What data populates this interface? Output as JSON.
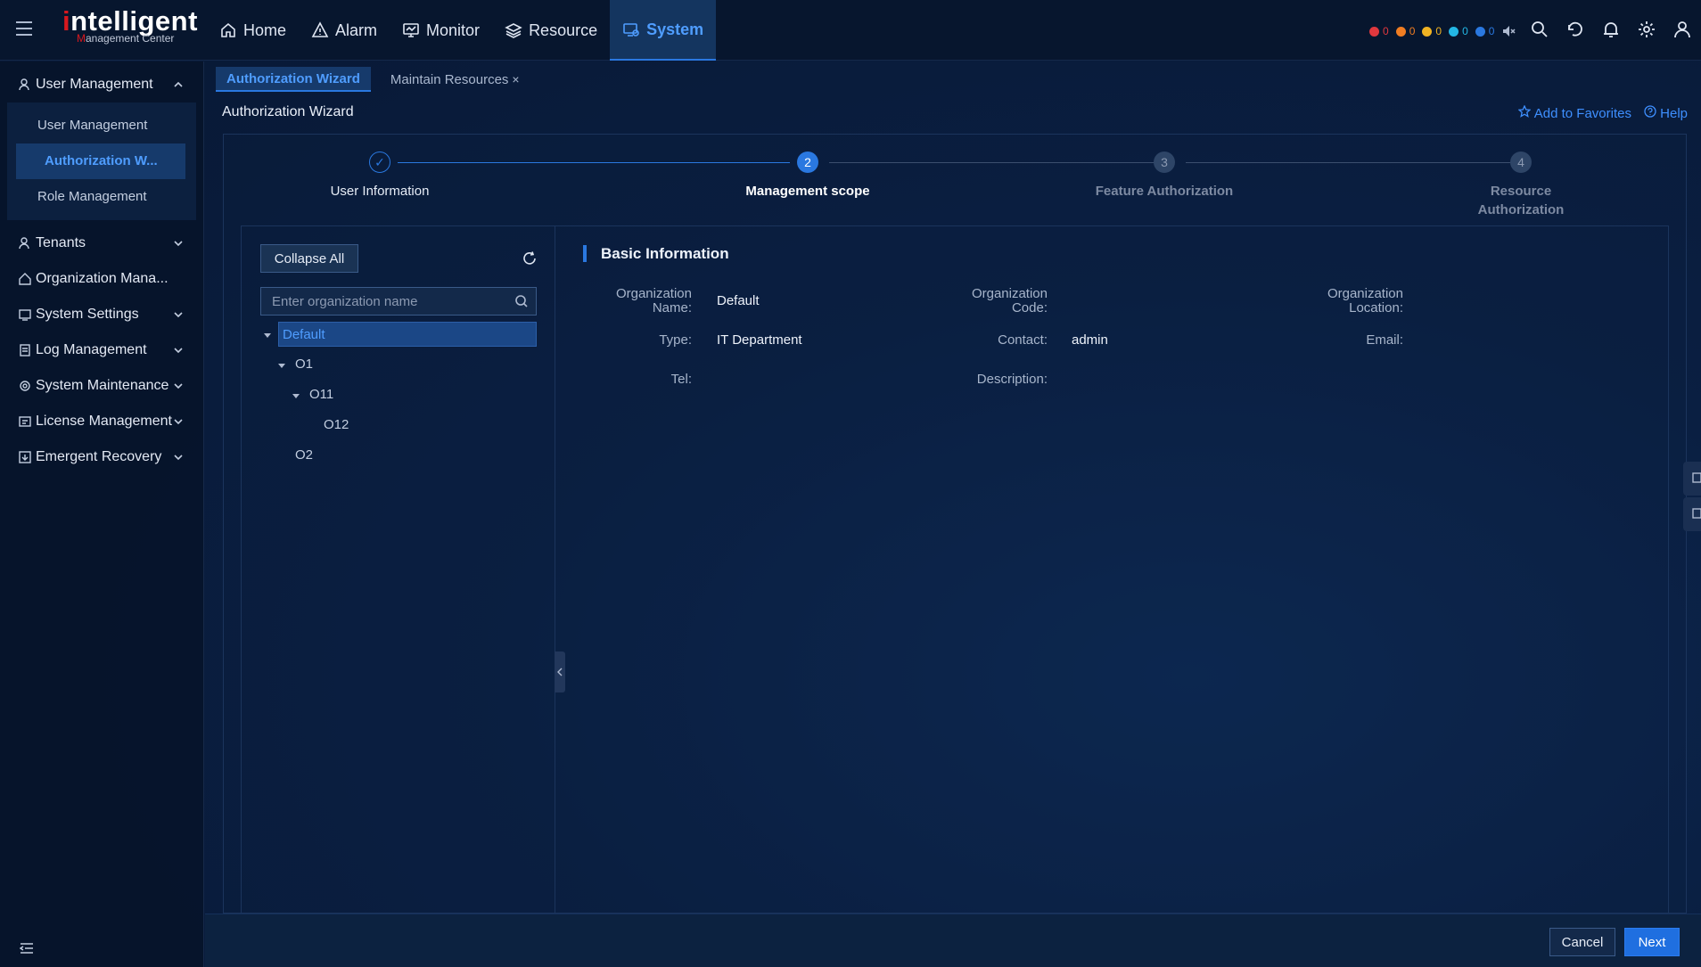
{
  "logo": {
    "initial": "i",
    "main": "ntelligent",
    "sub_initial": "M",
    "sub_rest": "anagement Center"
  },
  "nav": [
    {
      "label": "Home",
      "icon": "home-icon"
    },
    {
      "label": "Alarm",
      "icon": "alarm-icon"
    },
    {
      "label": "Monitor",
      "icon": "monitor-icon"
    },
    {
      "label": "Resource",
      "icon": "resource-icon"
    },
    {
      "label": "System",
      "icon": "system-icon",
      "active": true
    }
  ],
  "status": [
    {
      "color": "#e0383e",
      "count": "0"
    },
    {
      "color": "#f07d22",
      "count": "0"
    },
    {
      "color": "#f0b323",
      "count": "0"
    },
    {
      "color": "#23b7e5",
      "count": "0"
    },
    {
      "color": "#2a78e0",
      "count": "0"
    }
  ],
  "sidebar": {
    "user_management": "User Management",
    "sub": [
      "User Management",
      "Authorization W...",
      "Role Management"
    ],
    "items": [
      "Tenants",
      "Organization Mana...",
      "System Settings",
      "Log Management",
      "System Maintenance",
      "License Management",
      "Emergent Recovery"
    ]
  },
  "tabs": {
    "active": "Authorization Wizard",
    "other": "Maintain Resources",
    "close": "×"
  },
  "page": {
    "title": "Authorization Wizard",
    "favorites": "Add to Favorites",
    "help": "Help"
  },
  "steps": [
    {
      "num": "✓",
      "label": "User Information"
    },
    {
      "num": "2",
      "label": "Management scope"
    },
    {
      "num": "3",
      "label": "Feature Authorization"
    },
    {
      "num": "4",
      "label": "Resource Authorization"
    }
  ],
  "tree": {
    "collapse_all": "Collapse All",
    "search_placeholder": "Enter organization name",
    "nodes": [
      "Default",
      "O1",
      "O11",
      "O12",
      "O2"
    ]
  },
  "info": {
    "title": "Basic Information",
    "org_name_label": "Organization Name:",
    "org_name": "Default",
    "org_code_label": "Organization Code:",
    "org_code": "",
    "org_location_label": "Organization Location:",
    "org_location": "",
    "type_label": "Type:",
    "type": "IT Department",
    "contact_label": "Contact:",
    "contact": "admin",
    "email_label": "Email:",
    "email": "",
    "tel_label": "Tel:",
    "tel": "",
    "description_label": "Description:",
    "description": ""
  },
  "footer": {
    "cancel": "Cancel",
    "next": "Next"
  }
}
